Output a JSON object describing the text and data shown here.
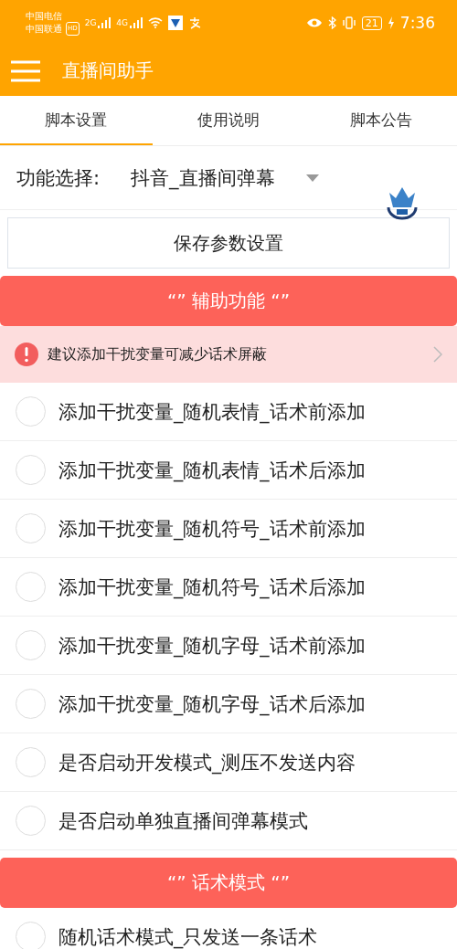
{
  "status_bar": {
    "carriers": [
      "中国电信",
      "中国联通"
    ],
    "hd_badge": "HD",
    "signals": [
      "2G",
      "4G"
    ],
    "battery": "21",
    "time": "7:36"
  },
  "app_bar": {
    "title": "直播间助手"
  },
  "tabs": [
    {
      "label": "脚本设置",
      "selected": true
    },
    {
      "label": "使用说明",
      "selected": false
    },
    {
      "label": "脚本公告",
      "selected": false
    }
  ],
  "function_select": {
    "label": "功能选择:",
    "value": "抖音_直播间弹幕"
  },
  "save_button": "保存参数设置",
  "sections": [
    {
      "title": "“” 辅助功能 “”",
      "notice": "建议添加干扰变量可减少话术屏蔽",
      "options": [
        {
          "label": "添加干扰变量_随机表情_话术前添加",
          "checked": false
        },
        {
          "label": "添加干扰变量_随机表情_话术后添加",
          "checked": false
        },
        {
          "label": "添加干扰变量_随机符号_话术前添加",
          "checked": false
        },
        {
          "label": "添加干扰变量_随机符号_话术后添加",
          "checked": false
        },
        {
          "label": "添加干扰变量_随机字母_话术前添加",
          "checked": false
        },
        {
          "label": "添加干扰变量_随机字母_话术后添加",
          "checked": false
        },
        {
          "label": "是否启动开发模式_测压不发送内容",
          "checked": false
        },
        {
          "label": "是否启动单独直播间弹幕模式",
          "checked": false
        }
      ]
    },
    {
      "title": "“” 话术模式 “”",
      "options": [
        {
          "label": "随机话术模式_只发送一条话术",
          "checked": false
        }
      ]
    }
  ]
}
